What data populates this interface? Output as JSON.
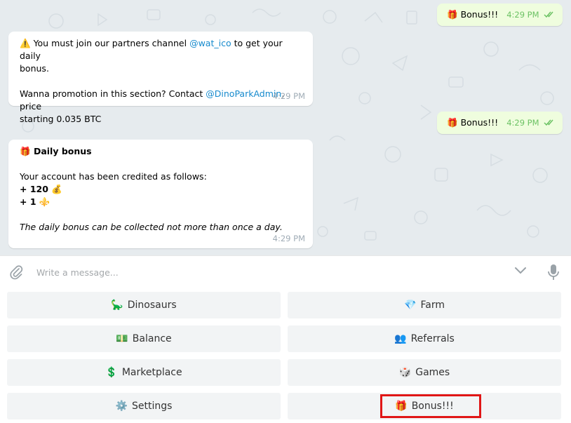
{
  "messages": {
    "out1": {
      "emoji": "🎁",
      "text": "Bonus!!!",
      "time": "4:29 PM"
    },
    "in1": {
      "warn_emoji": "⚠️",
      "line1_pre": "You must join our partners channel ",
      "line1_link": "@wat_ico",
      "line1_post": " to get your daily",
      "line2": "bonus.",
      "line3_pre": "Wanna promotion in this section? Contact ",
      "line3_link": "@DinoParkAdmin",
      "line3_post": ", price",
      "line4": "starting 0.035 BTC",
      "time": "4:29 PM"
    },
    "out2": {
      "emoji": "🎁",
      "text": "Bonus!!!",
      "time": "4:29 PM"
    },
    "in2": {
      "title_emoji": "🎁",
      "title": "Daily bonus",
      "line1": "Your account has been credited as follows:",
      "line2_text": "+ 120",
      "line2_emoji": "💰",
      "line3_text": "+ 1",
      "line3_emoji": "⚜️",
      "line4": "The daily bonus can be collected not more than once a day.",
      "time": "4:29 PM"
    }
  },
  "composer": {
    "placeholder": "Write a message..."
  },
  "keyboard": [
    {
      "emoji": "🦕",
      "label": "Dinosaurs"
    },
    {
      "emoji": "💎",
      "label": "Farm"
    },
    {
      "emoji": "💵",
      "label": "Balance"
    },
    {
      "emoji": "👥",
      "label": "Referrals"
    },
    {
      "emoji": "💲",
      "label": "Marketplace"
    },
    {
      "emoji": "🎲",
      "label": "Games"
    },
    {
      "emoji": "⚙️",
      "label": "Settings"
    },
    {
      "emoji": "🎁",
      "label": "Bonus!!!"
    }
  ],
  "colors": {
    "chat_bg": "#e6ebee",
    "bubble_in": "#ffffff",
    "bubble_out": "#effdde",
    "link": "#168acd",
    "highlight": "#e01616"
  }
}
